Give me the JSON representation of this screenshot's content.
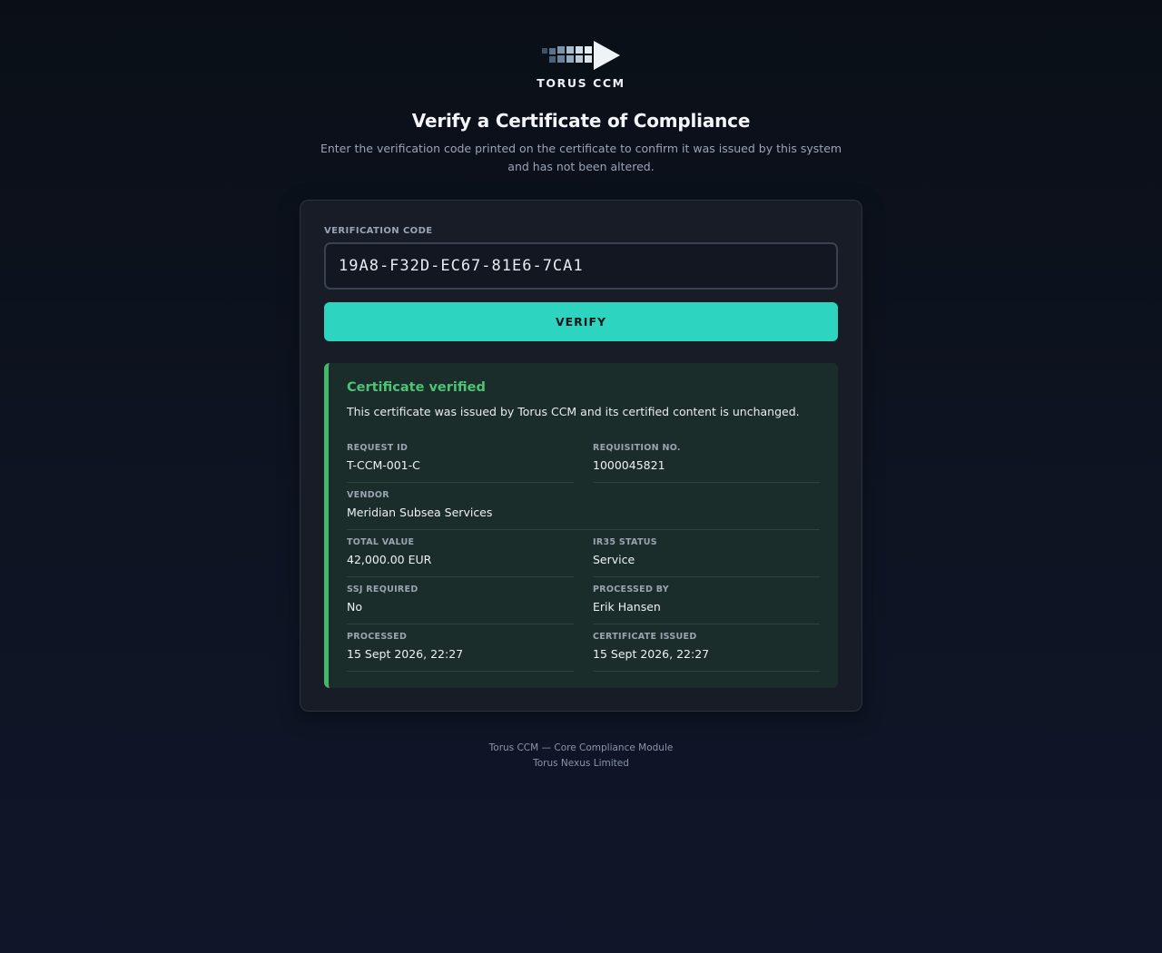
{
  "brand": {
    "logo_icon": "arrow-grid-logo-icon",
    "name": "TORUS CCM"
  },
  "header": {
    "title": "Verify a Certificate of Compliance",
    "subtitle": "Enter the verification code printed on the certificate to confirm it was issued by this system and has not been altered."
  },
  "form": {
    "code_label": "VERIFICATION CODE",
    "code_value": "19A8-F32D-EC67-81E6-7CA1",
    "verify_label": "VERIFY"
  },
  "result": {
    "title": "Certificate verified",
    "message": "This certificate was issued by Torus CCM and its certified content is unchanged.",
    "details": {
      "request_id": {
        "label": "REQUEST ID",
        "value": "T-CCM-001-C"
      },
      "requisition_no": {
        "label": "REQUISITION NO.",
        "value": "1000045821"
      },
      "vendor": {
        "label": "VENDOR",
        "value": "Meridian Subsea Services"
      },
      "total_value": {
        "label": "TOTAL VALUE",
        "value": "42,000.00 EUR"
      },
      "ir35_status": {
        "label": "IR35 STATUS",
        "value": "Service"
      },
      "ssj_required": {
        "label": "SSJ REQUIRED",
        "value": "No"
      },
      "processed_by": {
        "label": "PROCESSED BY",
        "value": "Erik Hansen"
      },
      "processed": {
        "label": "PROCESSED",
        "value": "15 Sept 2026, 22:27"
      },
      "certificate_issued": {
        "label": "CERTIFICATE ISSUED",
        "value": "15 Sept 2026, 22:27"
      }
    }
  },
  "footer": {
    "line1": "Torus CCM — Core Compliance Module",
    "line2": "Torus Nexus Limited"
  },
  "colors": {
    "accent": "#2dd4bf",
    "success": "#44b86a",
    "background": "#0e1422",
    "card": "#171c27"
  }
}
